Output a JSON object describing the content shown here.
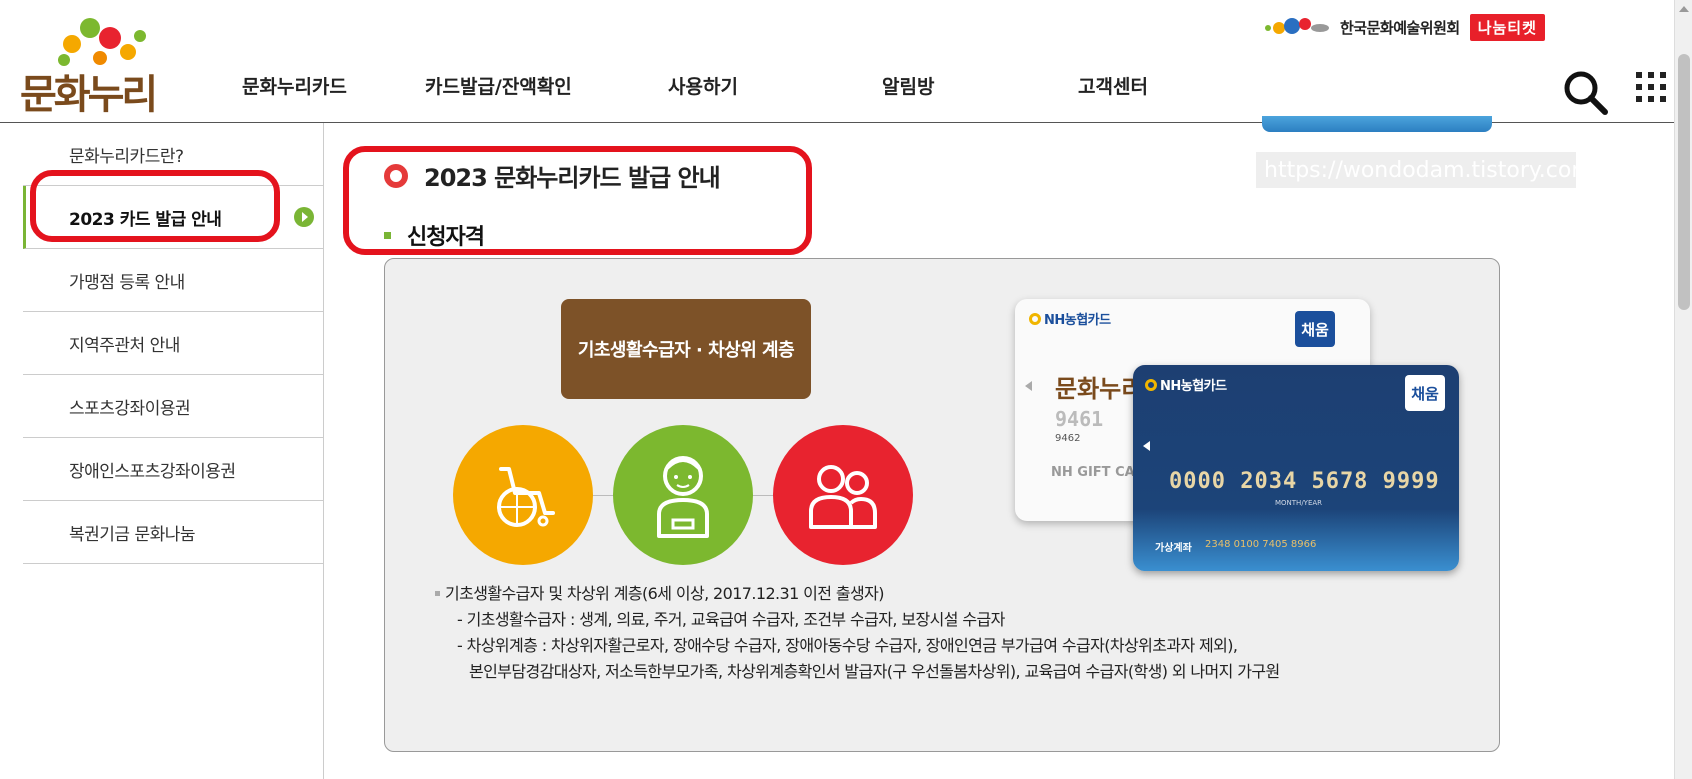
{
  "header": {
    "logo_text": "문화누리",
    "nav": [
      "문화누리카드",
      "카드발급/잔액확인",
      "사용하기",
      "알림방",
      "고객센터"
    ],
    "partner_text": "한국문화예술위원회",
    "nanum_ticket": "나눔티켓",
    "search_icon": "search-icon",
    "menu_icon": "grid-menu-icon"
  },
  "sidebar": {
    "items": [
      {
        "label": "문화누리카드란?"
      },
      {
        "label": "2023 카드 발급 안내",
        "active": true
      },
      {
        "label": "가맹점 등록 안내"
      },
      {
        "label": "지역주관처 안내"
      },
      {
        "label": "스포츠강좌이용권"
      },
      {
        "label": "장애인스포츠강좌이용권"
      },
      {
        "label": "복권기금 문화나눔"
      }
    ]
  },
  "main": {
    "section_title": "2023 문화누리카드 발급 안내",
    "subsection_title": "신청자격",
    "watermark": "https://wondodam.tistory.com",
    "eligibility_badge": "기초생활수급자 · 차상위 계층",
    "icons": [
      "wheelchair-icon",
      "elderly-icon",
      "family-icon"
    ],
    "icon_colors": [
      "#f5a800",
      "#7cb82f",
      "#e8232f"
    ],
    "card_white": {
      "brand": "NH농협카드",
      "badge": "채움",
      "logo": "문화누리",
      "number_partial": "9461",
      "number_small": "9462",
      "label": "NH GIFT CARD"
    },
    "card_blue": {
      "brand": "NH농협카드",
      "badge": "채움",
      "number": "0000 2034 5678 9999",
      "expiry_label": "MONTH/YEAR",
      "account_label": "가상계좌",
      "account_number": "2348 0100 7405 8966"
    },
    "description": {
      "line1": "기초생활수급자 및 차상위 계층(6세 이상, 2017.12.31 이전 출생자)",
      "line2": "- 기초생활수급자 : 생계, 의료, 주거, 교육급여 수급자, 조건부 수급자, 보장시설 수급자",
      "line3": "- 차상위계층 : 차상위자활근로자, 장애수당 수급자, 장애아동수당 수급자, 장애인연금 부가급여 수급자(차상위초과자 제외),",
      "line4": "본인부담경감대상자, 저소득한부모가족, 차상위계층확인서 발급자(구 우선돌봄차상위), 교육급여 수급자(학생) 외 나머지 가구원"
    }
  },
  "colors": {
    "accent_green": "#7ab535",
    "highlight_red": "#e4131d",
    "brown": "#7d5228"
  }
}
